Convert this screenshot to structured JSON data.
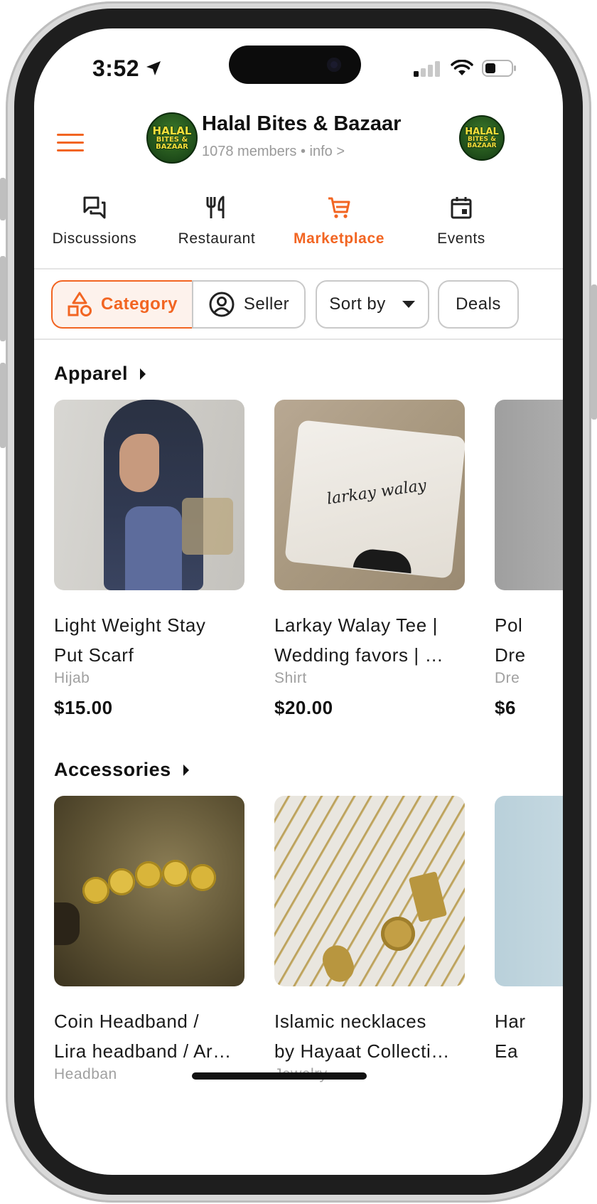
{
  "status": {
    "time": "3:52"
  },
  "header": {
    "group_name": "Halal Bites & Bazaar",
    "members": "1078 members • info >",
    "logo_line1": "HALAL",
    "logo_line2": "BITES &",
    "logo_line3": "BAZAAR"
  },
  "tabs": [
    {
      "label": "Discussions",
      "icon": "chat-icon",
      "active": false
    },
    {
      "label": "Restaurant",
      "icon": "fork-knife-icon",
      "active": false
    },
    {
      "label": "Marketplace",
      "icon": "cart-icon",
      "active": true
    },
    {
      "label": "Events",
      "icon": "calendar-icon",
      "active": false
    }
  ],
  "filters": {
    "category": "Category",
    "seller": "Seller",
    "sort": "Sort by",
    "deals": "Deals"
  },
  "sections": [
    {
      "title": "Apparel",
      "items": [
        {
          "title_line1": "Light Weight Stay",
          "title_line2": "Put Scarf",
          "category": "Hijab",
          "price": "$15.00"
        },
        {
          "title_line1": "Larkay Walay Tee |",
          "title_line2": "Wedding favors | …",
          "category": "Shirt",
          "price": "$20.00",
          "image_text": "larkay walay"
        },
        {
          "title_line1": "Pol",
          "title_line2": "Dre",
          "category": "Dre",
          "price": "$6"
        }
      ]
    },
    {
      "title": "Accessories",
      "items": [
        {
          "title_line1": "Coin Headband /",
          "title_line2": "Lira headband / Ar…",
          "category": "Headban"
        },
        {
          "title_line1": "Islamic necklaces",
          "title_line2": "by Hayaat Collecti…",
          "category": "Jewelry"
        },
        {
          "title_line1": "Har",
          "title_line2": "Ea"
        }
      ]
    }
  ],
  "colors": {
    "accent": "#f26522"
  }
}
